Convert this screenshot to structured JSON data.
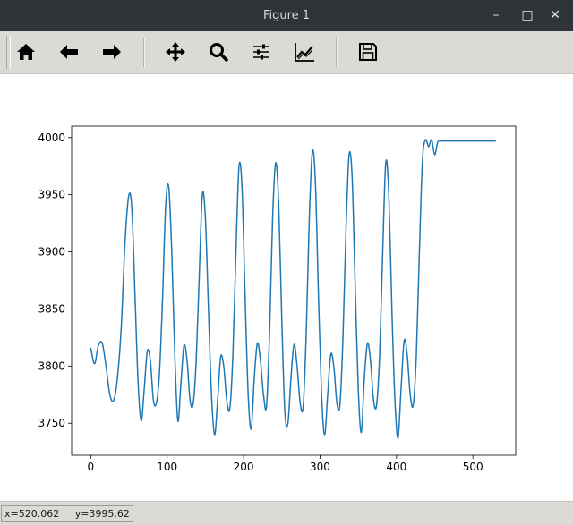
{
  "window": {
    "title": "Figure 1",
    "controls": [
      "minimize-icon",
      "maximize-icon",
      "close-icon"
    ]
  },
  "toolbar": {
    "buttons": [
      {
        "name": "home",
        "icon": "home-icon"
      },
      {
        "name": "back",
        "icon": "arrow-left-icon"
      },
      {
        "name": "forward",
        "icon": "arrow-right-icon"
      },
      {
        "name": "pan",
        "icon": "move-icon"
      },
      {
        "name": "zoom",
        "icon": "zoom-icon"
      },
      {
        "name": "subplots",
        "icon": "sliders-icon"
      },
      {
        "name": "edit-axes",
        "icon": "chart-line-icon"
      },
      {
        "name": "save",
        "icon": "floppy-disk-icon"
      }
    ]
  },
  "status": {
    "x_readout": "x=520.062",
    "y_readout": "y=3995.62"
  },
  "chart_data": {
    "type": "line",
    "title": "",
    "xlabel": "",
    "ylabel": "",
    "xlim": [
      -25,
      556
    ],
    "ylim": [
      3722,
      4010
    ],
    "xticks": [
      0,
      100,
      200,
      300,
      400,
      500
    ],
    "yticks": [
      3750,
      3800,
      3850,
      3900,
      3950,
      4000
    ],
    "grid": false,
    "line_color": "#1f77b4",
    "series": [
      {
        "x": [
          0,
          5,
          10,
          15,
          20,
          25,
          30,
          35,
          40,
          45,
          50,
          54,
          58,
          62,
          66,
          70,
          74,
          78,
          82,
          86,
          90,
          94,
          98,
          102,
          106,
          110,
          114,
          118,
          122,
          126,
          130,
          134,
          138,
          142,
          146,
          150,
          154,
          158,
          162,
          166,
          170,
          174,
          178,
          182,
          186,
          190,
          194,
          198,
          202,
          206,
          210,
          214,
          218,
          222,
          226,
          230,
          234,
          238,
          242,
          246,
          250,
          254,
          258,
          262,
          266,
          270,
          274,
          278,
          282,
          286,
          290,
          294,
          298,
          302,
          306,
          310,
          314,
          318,
          322,
          326,
          330,
          334,
          338,
          342,
          346,
          350,
          354,
          358,
          362,
          366,
          370,
          374,
          378,
          382,
          386,
          390,
          394,
          398,
          402,
          406,
          410,
          414,
          418,
          422,
          426,
          430,
          434,
          438,
          442,
          446,
          450,
          454,
          458,
          462,
          466,
          470,
          474,
          478,
          482,
          486,
          490,
          494,
          498,
          502,
          506,
          510,
          514,
          518,
          522,
          526,
          530
        ],
        "values": [
          3816,
          3802,
          3818,
          3820,
          3800,
          3775,
          3770,
          3790,
          3835,
          3910,
          3950,
          3935,
          3860,
          3785,
          3752,
          3780,
          3813,
          3805,
          3770,
          3768,
          3795,
          3860,
          3940,
          3957,
          3900,
          3810,
          3752,
          3785,
          3818,
          3805,
          3770,
          3767,
          3805,
          3880,
          3950,
          3930,
          3850,
          3775,
          3740,
          3770,
          3808,
          3800,
          3770,
          3763,
          3810,
          3900,
          3975,
          3955,
          3860,
          3775,
          3745,
          3790,
          3820,
          3805,
          3775,
          3765,
          3830,
          3930,
          3978,
          3940,
          3840,
          3760,
          3750,
          3790,
          3819,
          3800,
          3768,
          3765,
          3830,
          3930,
          3988,
          3960,
          3860,
          3775,
          3740,
          3775,
          3810,
          3800,
          3768,
          3766,
          3825,
          3920,
          3985,
          3965,
          3870,
          3780,
          3742,
          3790,
          3820,
          3805,
          3770,
          3766,
          3810,
          3900,
          3978,
          3950,
          3850,
          3770,
          3737,
          3780,
          3822,
          3810,
          3775,
          3766,
          3810,
          3900,
          3980,
          3998,
          3992,
          3998,
          3985,
          3996,
          3997,
          3997,
          3997,
          3997,
          3997,
          3997,
          3997,
          3997,
          3997,
          3997,
          3997,
          3997,
          3997,
          3997,
          3997,
          3997,
          3997,
          3997,
          3997
        ]
      }
    ]
  }
}
